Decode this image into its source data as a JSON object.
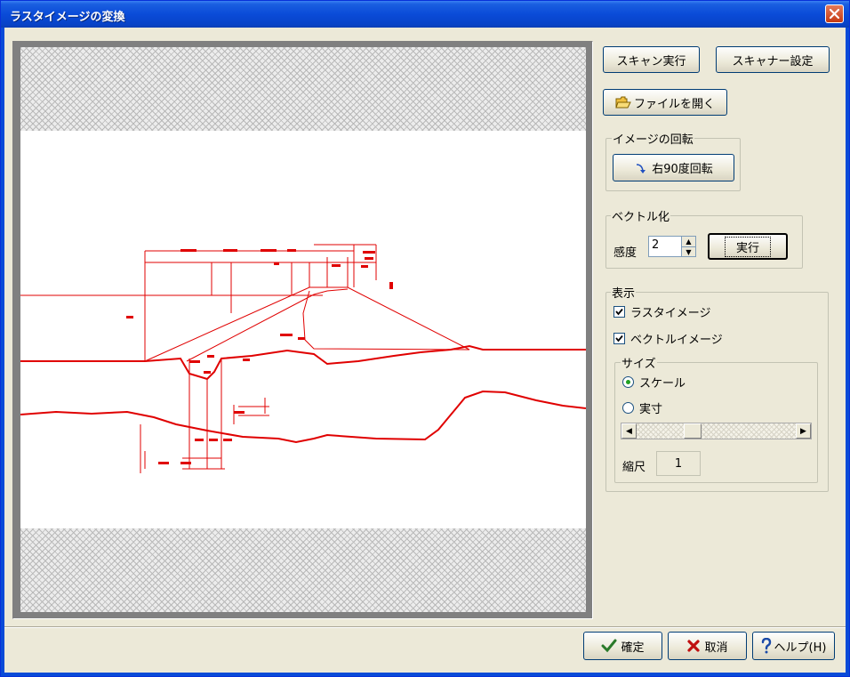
{
  "window": {
    "title": "ラスタイメージの変換"
  },
  "toolbar": {
    "scan_execute": "スキャン実行",
    "scanner_settings": "スキャナー設定",
    "open_file": "ファイルを開く"
  },
  "rotation": {
    "group_label": "イメージの回転",
    "rotate_right": "右90度回転"
  },
  "vectorize": {
    "group_label": "ベクトル化",
    "sensitivity_label": "感度",
    "sensitivity_value": "2",
    "execute": "実行"
  },
  "display": {
    "group_label": "表示",
    "raster_image": {
      "label": "ラスタイメージ",
      "checked": true
    },
    "vector_image": {
      "label": "ベクトルイメージ",
      "checked": true
    },
    "size": {
      "group_label": "サイズ",
      "options": [
        {
          "label": "スケール",
          "selected": true
        },
        {
          "label": "実寸",
          "selected": false
        }
      ],
      "scale_label": "縮尺",
      "scale_value": "1"
    }
  },
  "footer": {
    "ok": "確定",
    "cancel": "取消",
    "help": "ヘルプ(H)"
  },
  "icons": {
    "close": "close-icon",
    "folder": "open-folder-icon",
    "rotate": "rotate-right-icon",
    "ok": "checkmark-icon",
    "cancel": "x-icon",
    "help": "question-icon"
  },
  "colors": {
    "drawing": "#e00000",
    "title_bar": "#0a4bd8",
    "dialog_bg": "#ece9d8"
  }
}
